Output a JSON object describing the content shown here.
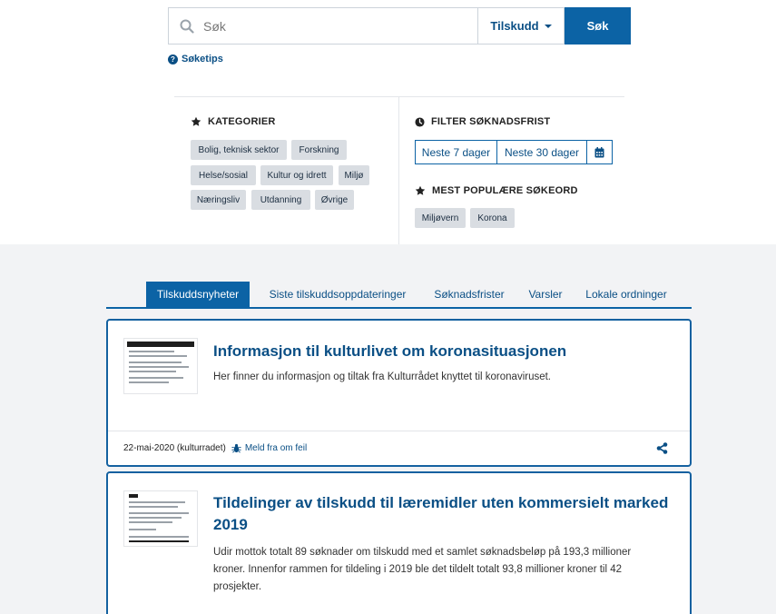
{
  "search": {
    "placeholder": "Søk",
    "type_label": "Tilskudd",
    "button_label": "Søk",
    "tips_label": "Søketips"
  },
  "categories": {
    "heading": "KATEGORIER",
    "tags": [
      "Bolig, teknisk sektor",
      "Forskning",
      "Helse/sosial",
      "Kultur og idrett",
      "Miljø",
      "Næringsliv",
      "Utdanning",
      "Øvrige"
    ]
  },
  "deadline_filter": {
    "heading": "FILTER SØKNADSFRIST",
    "options": [
      "Neste 7 dager",
      "Neste 30 dager"
    ],
    "calendar_icon": "calendar-icon"
  },
  "popular": {
    "heading": "MEST POPULÆRE SØKEORD",
    "tags": [
      "Miljøvern",
      "Korona"
    ]
  },
  "tabs": {
    "active": "Tilskuddsnyheter",
    "items": [
      "Tilskuddsnyheter",
      "Siste tilskuddsoppdateringer",
      "Søknadsfrister",
      "Varsler",
      "Lokale ordninger"
    ]
  },
  "articles": [
    {
      "title": "Informasjon til kulturlivet om koronasituasjonen",
      "description": "Her finner du informasjon og tiltak fra Kulturrådet knyttet til koronaviruset.",
      "date_source": "22-mai-2020 (kulturradet)",
      "report_label": "Meld fra om feil"
    },
    {
      "title_line1": "Tildelinger av tilskudd til læremidler uten kommersielt marked",
      "title_line2": "2019",
      "desc_line1": "Udir mottok totalt 89 søknader om tilskudd med et samlet søknadsbeløp på 193,3 millioner",
      "desc_line2": "kroner. Innenfor rammen for tildeling i 2019 ble det tildelt totalt 93,8 millioner kroner til 42",
      "desc_line3": "prosjekter."
    }
  ],
  "colors": {
    "primary": "#0c63a5",
    "link": "#0a4f85",
    "tag_bg": "#d9dde2",
    "page_bg": "#f2f3f5",
    "card_border": "#1461a0"
  }
}
